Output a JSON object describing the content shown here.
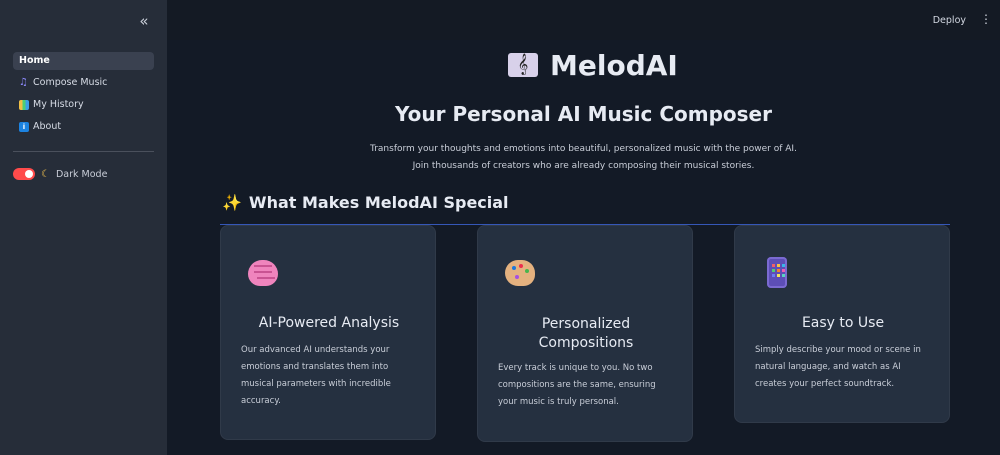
{
  "sidebar": {
    "collapse_glyph": "«",
    "items": [
      {
        "label": "Home",
        "icon": "none"
      },
      {
        "label": "Compose Music",
        "icon": "music-note-icon"
      },
      {
        "label": "My History",
        "icon": "books-icon"
      },
      {
        "label": "About",
        "icon": "info-icon"
      }
    ],
    "dark_mode": {
      "label": "Dark Mode",
      "enabled": true
    }
  },
  "topbar": {
    "deploy_label": "Deploy",
    "menu_glyph": "⋮"
  },
  "main": {
    "app_icon_glyph": "𝄞",
    "app_name": "MelodAI",
    "hero_title": "Your Personal AI Music Composer",
    "hero_description": "Transform your thoughts and emotions into beautiful, personalized music with the power of AI. Join thousands of creators who are already composing their musical stories.",
    "section_icon_glyph": "✨",
    "section_title": "What Makes MelodAI Special",
    "features": [
      {
        "icon": "brain-icon",
        "title": "AI-Powered Analysis",
        "text": "Our advanced AI understands your emotions and translates them into musical parameters with incredible accuracy."
      },
      {
        "icon": "palette-icon",
        "title": "Personalized Compositions",
        "text": "Every track is unique to you. No two compositions are the same, ensuring your music is truly personal."
      },
      {
        "icon": "mobile-phone-icon",
        "title": "Easy to Use",
        "text": "Simply describe your mood or scene in natural language, and watch as AI creates your perfect soundtrack."
      }
    ]
  },
  "colors": {
    "sidebar_bg": "#262d39",
    "main_bg": "#131a26",
    "card_bg": "#253040",
    "toggle_on": "#ff4b4b",
    "section_rule": "#3557b8"
  }
}
